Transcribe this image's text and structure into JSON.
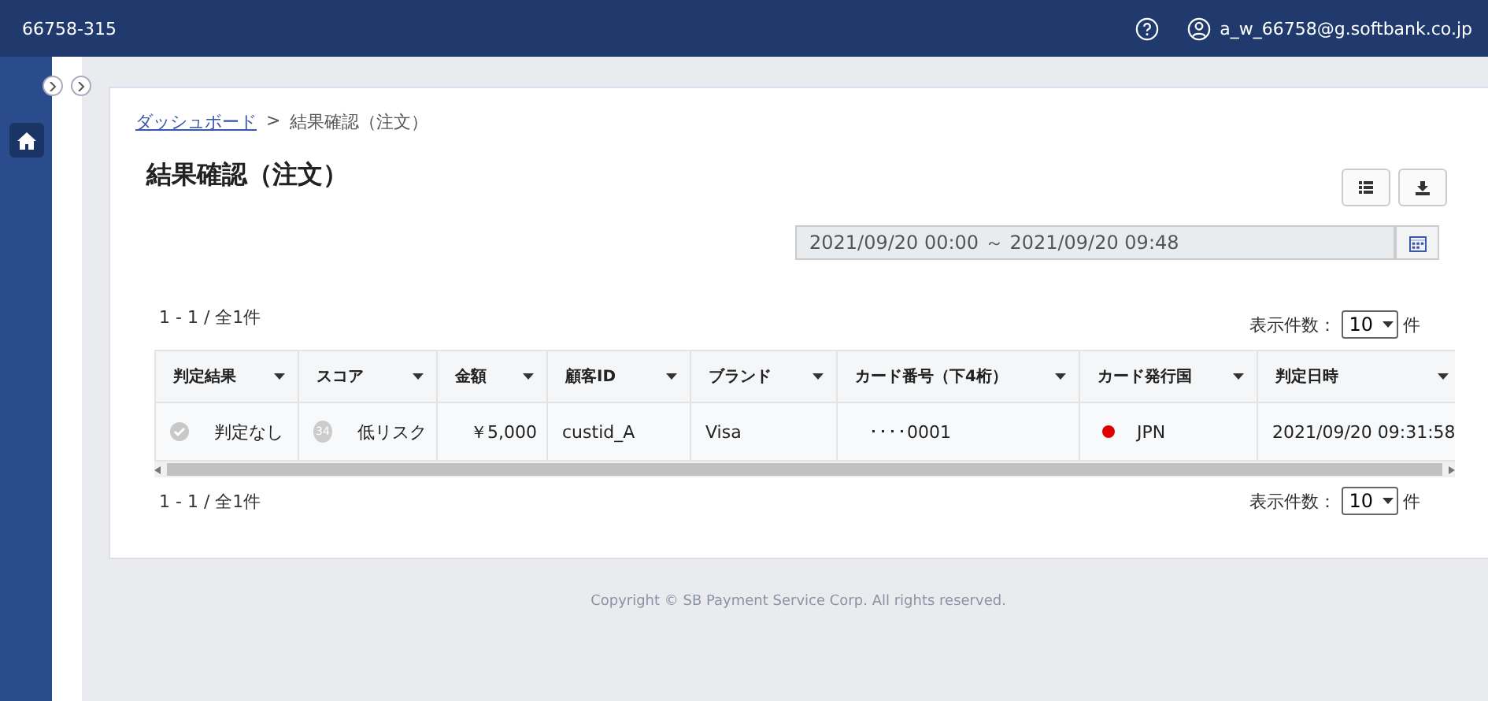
{
  "header": {
    "account_code": "66758-315",
    "user_email": "a_w_66758@g.softbank.co.jp"
  },
  "breadcrumb": [
    {
      "label": "ダッシュボード",
      "link": true
    },
    {
      "label": "結果確認（注文）",
      "link": false
    }
  ],
  "breadcrumb_separator": ">",
  "page_title": "結果確認（注文）",
  "date_range": "2021/09/20 00:00 ～ 2021/09/20 09:48",
  "summary_top": "1 - 1 / 全1件",
  "summary_bottom": "1 - 1 / 全1件",
  "page_size_top": {
    "label": "表示件数：",
    "value": "10",
    "unit": "件"
  },
  "page_size_bottom": {
    "label": "表示件数：",
    "value": "10",
    "unit": "件"
  },
  "table": {
    "columns": [
      "判定結果",
      "スコア",
      "金額",
      "顧客ID",
      "ブランド",
      "カード番号（下4桁）",
      "カード発行国",
      "判定日時"
    ],
    "rows": [
      {
        "result": "判定なし",
        "score_badge": "34",
        "score": "低リスク",
        "amount": "￥5,000",
        "customer_id": "custid_A",
        "brand": "Visa",
        "card_number": "････0001",
        "country": {
          "code": "JPN",
          "color": "#dd0000"
        },
        "judged_at": "2021/09/20 09:31:58"
      }
    ]
  },
  "footer": "Copyright © SB Payment Service Corp. All rights reserved."
}
